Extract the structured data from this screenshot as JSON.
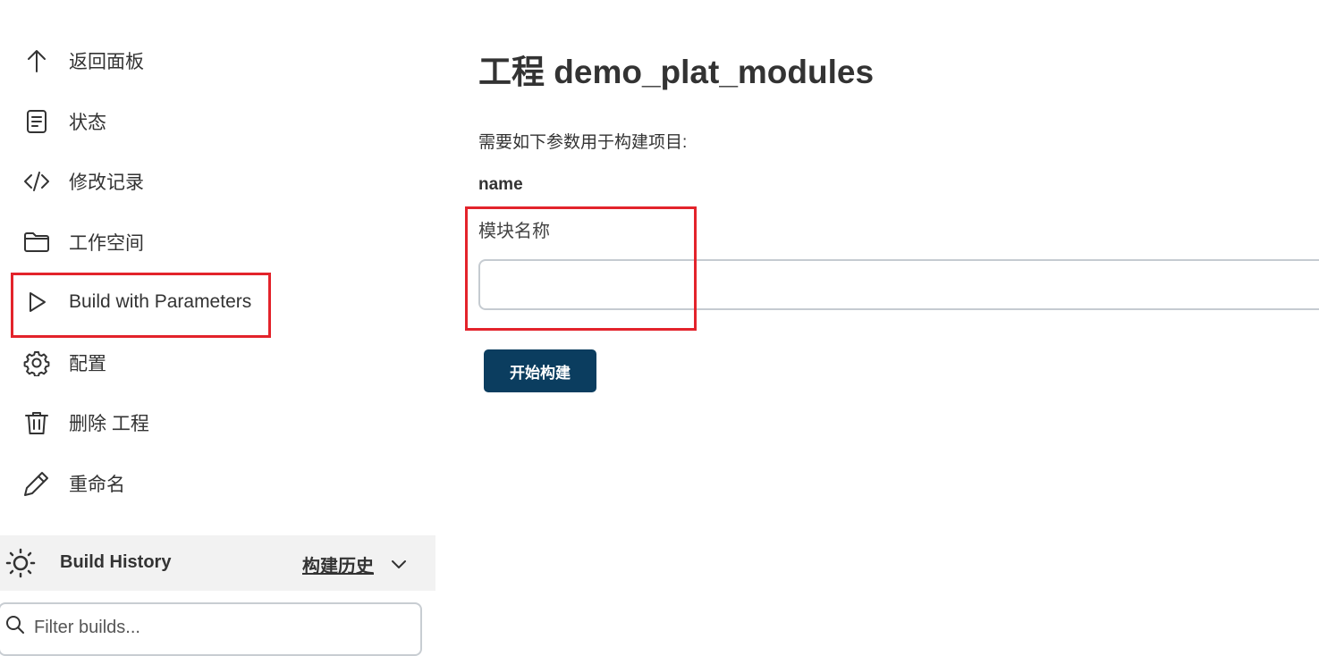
{
  "sidebar": {
    "items": [
      {
        "label": "返回面板",
        "icon": "arrow-up-icon"
      },
      {
        "label": "状态",
        "icon": "document-icon"
      },
      {
        "label": "修改记录",
        "icon": "code-icon"
      },
      {
        "label": "工作空间",
        "icon": "folder-icon"
      },
      {
        "label": "Build with Parameters",
        "icon": "play-icon"
      },
      {
        "label": "配置",
        "icon": "gear-icon"
      },
      {
        "label": "删除 工程",
        "icon": "trash-icon"
      },
      {
        "label": "重命名",
        "icon": "pencil-icon"
      }
    ]
  },
  "build_history": {
    "title": "Build History",
    "link": "构建历史",
    "icon": "sun-icon",
    "filter_placeholder": "Filter builds..."
  },
  "main": {
    "title": "工程 demo_plat_modules",
    "description": "需要如下参数用于构建项目:",
    "parameter": {
      "name": "name",
      "description": "模块名称",
      "value": ""
    },
    "build_button": "开始构建"
  },
  "colors": {
    "highlight": "#e3232b",
    "button_bg": "#0b3d5f",
    "history_bg": "#f2f2f2"
  }
}
